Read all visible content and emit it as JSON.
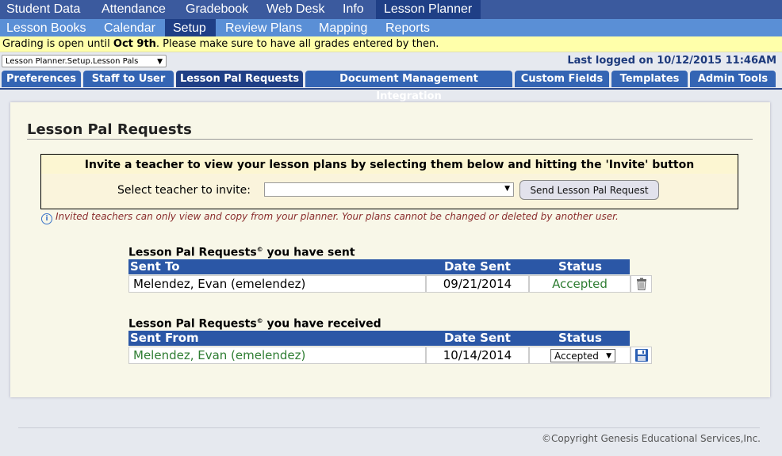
{
  "top_nav": [
    "Student Data",
    "Attendance",
    "Gradebook",
    "Web Desk",
    "Info",
    "Lesson Planner"
  ],
  "sub_nav": [
    "Lesson Books",
    "Calendar",
    "Setup",
    "Review Plans",
    "Mapping",
    "Reports"
  ],
  "alert": {
    "prefix": "Grading is open until ",
    "date": "Oct 9th",
    "suffix": ". Please make sure to have all grades entered by then."
  },
  "breadcrumb": "Lesson Planner.Setup.Lesson Pals",
  "last_logged": "Last logged on 10/12/2015 11:46AM",
  "tabs": [
    "Preferences",
    "Staff to User",
    "Lesson Pal Requests",
    "Document Management Integration",
    "Custom Fields",
    "Templates",
    "Admin Tools"
  ],
  "panel_title": "Lesson Pal Requests",
  "invite": {
    "heading": "Invite a teacher to view your lesson plans by selecting them below and hitting the 'Invite' button",
    "select_label": "Select teacher to invite:",
    "select_value": "",
    "button": "Send Lesson Pal Request"
  },
  "note": "Invited teachers can only view and copy from your planner. Your plans cannot be changed or deleted by another user.",
  "sent": {
    "title": "Lesson Pal Requests",
    "title_suffix": " you have sent",
    "columns": [
      "Sent To",
      "Date Sent",
      "Status"
    ],
    "rows": [
      {
        "name": "Melendez, Evan (emelendez)",
        "date": "09/21/2014",
        "status": "Accepted"
      }
    ]
  },
  "received": {
    "title": "Lesson Pal Requests",
    "title_suffix": " you have received",
    "columns": [
      "Sent From",
      "Date Sent",
      "Status"
    ],
    "rows": [
      {
        "name": "Melendez, Evan (emelendez)",
        "date": "10/14/2014",
        "status": "Accepted"
      }
    ]
  },
  "footer": "©Copyright Genesis Educational Services,Inc.",
  "colors": {
    "nav": "#3b5a9e",
    "subnav": "#5a8fd6",
    "active": "#1f3f86",
    "accent_green": "#2e7d32",
    "alert_bg": "#ffffaa"
  },
  "icons": {
    "info": "info-icon",
    "delete": "trash-icon",
    "save": "save-icon"
  }
}
